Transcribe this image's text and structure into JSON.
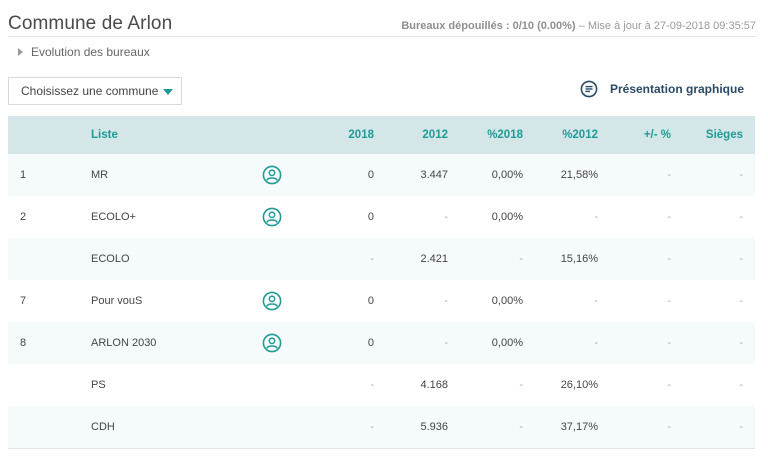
{
  "header": {
    "title": "Commune de Arlon",
    "bureaux": "Bureaux dépouillés : 0/10 (0.00%)",
    "updated": " – Mise à jour à 27-09-2018 09:35:57"
  },
  "evolution_label": "Evolution des bureaux",
  "commune_select": {
    "value": "Choisissez une commune"
  },
  "graph_link_label": "Présentation graphique",
  "colors": {
    "accent": "#1e9b95",
    "header_bg": "#d4e6e8",
    "link": "#2a4a66"
  },
  "table": {
    "columns": {
      "liste": "Liste",
      "y2018": "2018",
      "y2012": "2012",
      "p2018": "%2018",
      "p2012": "%2012",
      "diff": "+/- %",
      "sieges": "Sièges"
    },
    "rows": [
      {
        "rank": "1",
        "liste": "MR",
        "has_candidates": true,
        "y2018": "0",
        "y2012": "3.447",
        "p2018": "0,00%",
        "p2012": "21,58%",
        "diff": "-",
        "sieges": "-"
      },
      {
        "rank": "2",
        "liste": "ECOLO+",
        "has_candidates": true,
        "y2018": "0",
        "y2012": "-",
        "p2018": "0,00%",
        "p2012": "-",
        "diff": "-",
        "sieges": "-"
      },
      {
        "rank": "",
        "liste": "ECOLO",
        "has_candidates": false,
        "y2018": "-",
        "y2012": "2.421",
        "p2018": "-",
        "p2012": "15,16%",
        "diff": "-",
        "sieges": "-"
      },
      {
        "rank": "7",
        "liste": "Pour vouS",
        "has_candidates": true,
        "y2018": "0",
        "y2012": "-",
        "p2018": "0,00%",
        "p2012": "-",
        "diff": "-",
        "sieges": "-"
      },
      {
        "rank": "8",
        "liste": "ARLON 2030",
        "has_candidates": true,
        "y2018": "0",
        "y2012": "-",
        "p2018": "0,00%",
        "p2012": "-",
        "diff": "-",
        "sieges": "-"
      },
      {
        "rank": "",
        "liste": "PS",
        "has_candidates": false,
        "y2018": "-",
        "y2012": "4.168",
        "p2018": "-",
        "p2012": "26,10%",
        "diff": "-",
        "sieges": "-"
      },
      {
        "rank": "",
        "liste": "CDH",
        "has_candidates": false,
        "y2018": "-",
        "y2012": "5.936",
        "p2018": "-",
        "p2012": "37,17%",
        "diff": "-",
        "sieges": "-"
      }
    ]
  }
}
